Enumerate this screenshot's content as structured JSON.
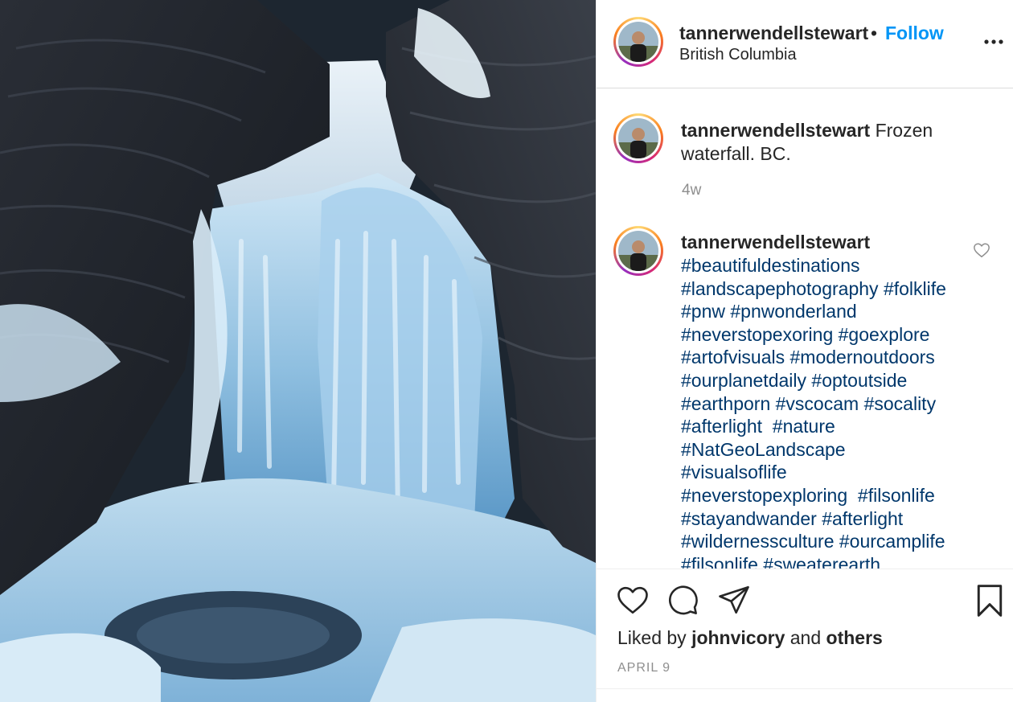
{
  "post": {
    "username": "tannerwendellstewart",
    "separator": "•",
    "follow_label": "Follow",
    "location": "British Columbia",
    "more_icon": "more-horizontal-icon"
  },
  "caption": {
    "username": "tannerwendellstewart",
    "text": "Frozen waterfall. BC.",
    "time": "4w"
  },
  "comment": {
    "username": "tannerwendellstewart",
    "hashtags": [
      "#beautifuldestinations",
      "#landscapephotography",
      "#folklife",
      "#pnw",
      "#pnwonderland",
      "#neverstopexoring",
      "#goexplore",
      "#artofvisuals",
      "#modernoutdoors",
      "#ourplanetdaily",
      "#optoutside",
      "#earthporn",
      "#vscocam",
      "#socality",
      "#afterlight",
      "#nature",
      "#NatGeoLandscape",
      "#visualsoflife",
      "#neverstopexploring",
      "#filsonlife",
      "#stayandwander",
      "#afterlight",
      "#wildernessculture",
      "#ourcamplife",
      "#filsonlife",
      "#sweaterearth"
    ]
  },
  "actions": {
    "icons": [
      "heart-icon",
      "comment-icon",
      "share-icon",
      "bookmark-icon"
    ],
    "liked_by_prefix": "Liked by",
    "liked_by_user": "johnvicory",
    "liked_by_and": "and",
    "liked_by_others": "others",
    "date": "APRIL 9"
  },
  "colors": {
    "link_blue": "#0095f6",
    "hashtag_blue": "#00376b",
    "muted_gray": "#8e8e8e",
    "text": "#262626"
  }
}
